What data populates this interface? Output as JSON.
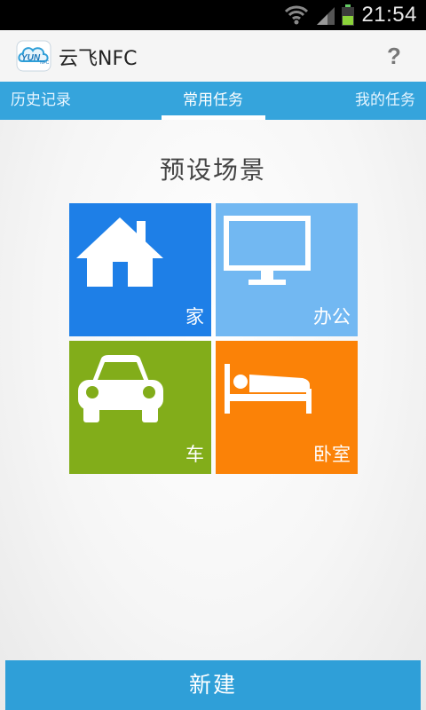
{
  "status_bar": {
    "time": "21:54"
  },
  "app_bar": {
    "logo_text": "YUN",
    "logo_sub": "NFC",
    "title": "云飞NFC",
    "help_label": "?"
  },
  "tabs": [
    {
      "label": "历史记录",
      "selected": false
    },
    {
      "label": "常用任务",
      "selected": true
    },
    {
      "label": "我的任务",
      "selected": false
    }
  ],
  "main": {
    "section_title": "预设场景",
    "tiles": [
      {
        "label": "家",
        "icon": "house-icon",
        "color": "#1e7fe7"
      },
      {
        "label": "办公",
        "icon": "monitor-icon",
        "color": "#72b8f2"
      },
      {
        "label": "车",
        "icon": "car-icon",
        "color": "#82ad1a"
      },
      {
        "label": "卧室",
        "icon": "bed-icon",
        "color": "#fb8207"
      }
    ]
  },
  "footer": {
    "new_button_label": "新建"
  },
  "colors": {
    "accent": "#35a4dc",
    "button": "#2f9fd8"
  }
}
